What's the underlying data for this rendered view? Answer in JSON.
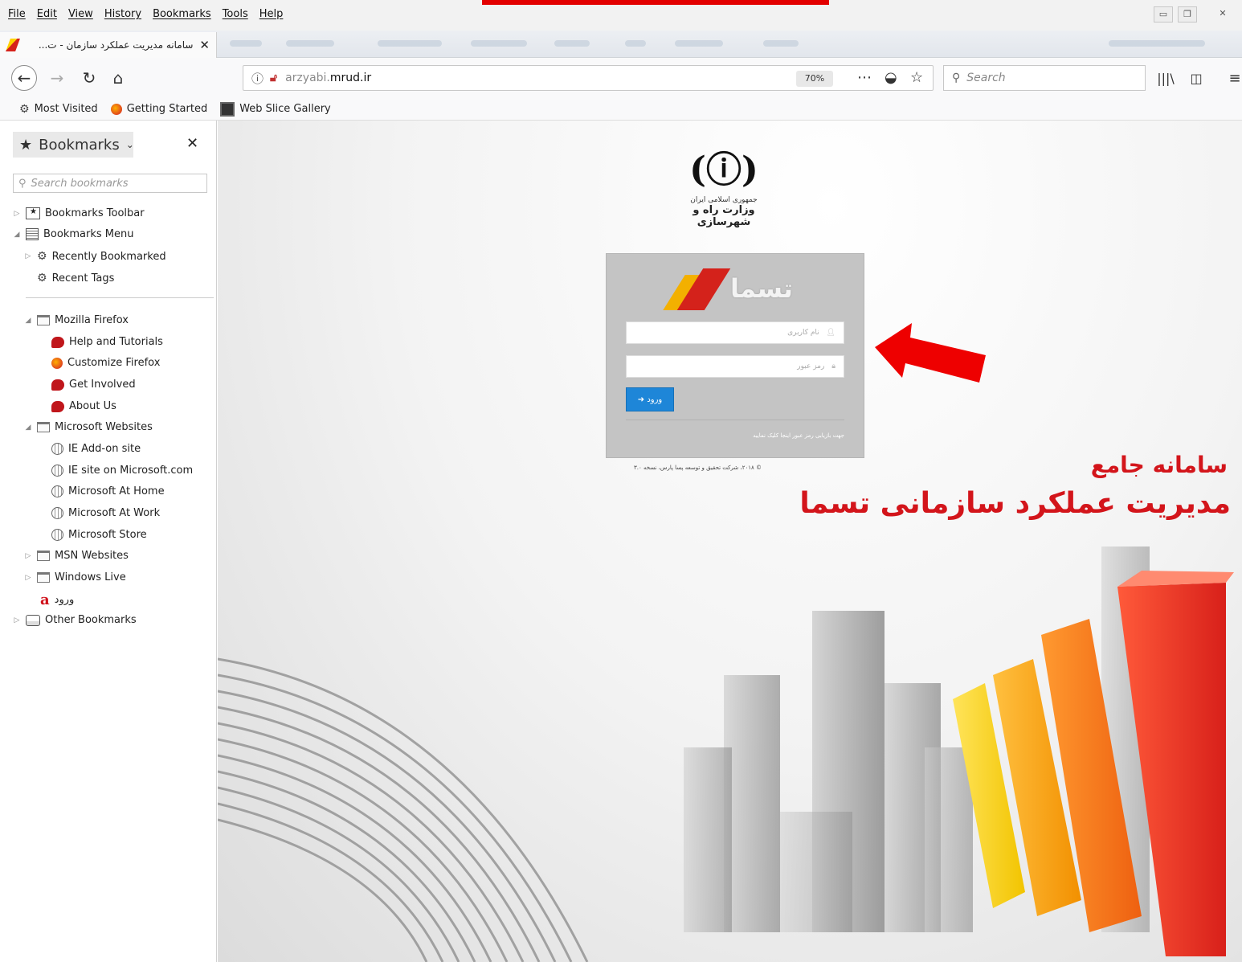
{
  "menubar": {
    "items": [
      "File",
      "Edit",
      "View",
      "History",
      "Bookmarks",
      "Tools",
      "Help"
    ],
    "window_controls": [
      "minimize",
      "restore",
      "close"
    ]
  },
  "tab": {
    "title": "سامانه مدیریت عملکرد سازمان - ت...",
    "close": "✕"
  },
  "navbar": {
    "url_subdomain": "arzyabi.",
    "url_domain": "mrud.ir",
    "zoom": "70%",
    "search_placeholder": "Search"
  },
  "bookmarks_toolbar": {
    "items": [
      "Most Visited",
      "Getting Started",
      "Web Slice Gallery"
    ]
  },
  "sidebar": {
    "header": "Bookmarks",
    "search_placeholder": "Search bookmarks",
    "tree": {
      "bookmarks_toolbar": "Bookmarks Toolbar",
      "bookmarks_menu": "Bookmarks Menu",
      "recently_bookmarked": "Recently Bookmarked",
      "recent_tags": "Recent Tags",
      "mozilla_firefox": "Mozilla Firefox",
      "help_tutorials": "Help and Tutorials",
      "customize_firefox": "Customize Firefox",
      "get_involved": "Get Involved",
      "about_us": "About Us",
      "microsoft_websites": "Microsoft Websites",
      "ie_addon": "IE Add-on site",
      "ie_site": "IE site on Microsoft.com",
      "ms_home": "Microsoft At Home",
      "ms_work": "Microsoft At Work",
      "ms_store": "Microsoft Store",
      "msn_websites": "MSN Websites",
      "windows_live": "Windows Live",
      "vorood": "ورود",
      "other_bookmarks": "Other Bookmarks"
    }
  },
  "page": {
    "emblem_line1": "جمهوری اسلامی ایران",
    "emblem_line2": "وزارت راه و شهرسازی",
    "logo_text": "تسما",
    "username_placeholder": "نام کاربری",
    "password_placeholder": "رمز عبور",
    "login_button": "ورود",
    "forgot_text": "جهت بازیابی رمز عبور اینجا کلیک نمایید",
    "copyright": "© ۲۰۱۸، شرکت تحقیق و توسعه پسا پارس، نسخه ۳.۰",
    "hero_line1": "سامانه جامع",
    "hero_line2": "مدیریت عملکرد سازمانی تسما"
  },
  "colors": {
    "accent_red": "#d3151b",
    "login_button": "#1e86d8",
    "arrow": "#ee0000"
  }
}
